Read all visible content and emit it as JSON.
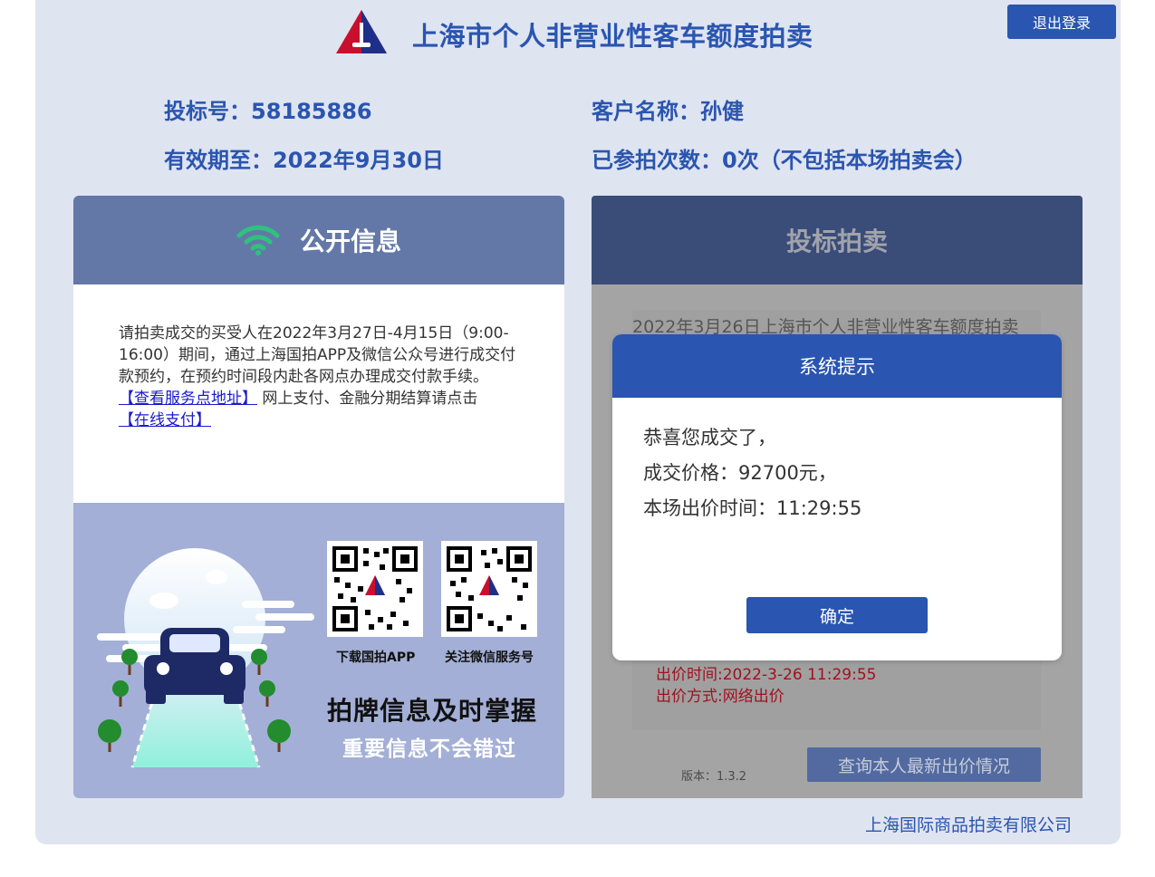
{
  "header": {
    "title": "上海市个人非营业性客车额度拍卖",
    "logout_label": "退出登录"
  },
  "bidder": {
    "bid_no": "投标号：58185886",
    "customer": "客户名称：孙健",
    "valid_until": "有效期至：2022年9月30日",
    "attempts": "已参拍次数：0次（不包括本场拍卖会）"
  },
  "public_info": {
    "title": "公开信息",
    "notice_text": "请拍卖成交的买受人在2022年3月27日-4月15日（9:00-16:00）期间，通过上海国拍APP及微信公众号进行成交付款预约，在预约时间段内赴各网点办理成交付款手续。",
    "service_link": "【查看服务点地址】",
    "pay_text": " 网上支付、金融分期结算请点击",
    "pay_link": "【在线支付】"
  },
  "promo": {
    "qr_app_caption": "下载国拍APP",
    "qr_wechat_caption": "关注微信服务号",
    "slogan_main": "拍牌信息及时掌握",
    "slogan_sub": "重要信息不会错过"
  },
  "bidding": {
    "title": "投标拍卖",
    "auction_name": "2022年3月26日上海市个人非营业性客车额度拍卖",
    "bid_time": "出价时间:2022-3-26 11:29:55",
    "bid_method": "出价方式:网络出价",
    "query_label": "查询本人最新出价情况",
    "version": "版本：1.3.2"
  },
  "footer": {
    "company": "上海国际商品拍卖有限公司"
  },
  "modal": {
    "title": "系统提示",
    "line1": "恭喜您成交了，",
    "line2": "成交价格：92700元，",
    "line3": "本场出价时间：11:29:55",
    "ok_label": "确定"
  },
  "colors": {
    "brand_blue": "#2a55b0",
    "header_bar": "#6478a8",
    "promo_bg": "#a3afd6",
    "alert_red": "#a0111d",
    "wifi_green": "#2ec27e"
  },
  "icons": {
    "logo": "auction-logo-icon",
    "wifi": "wifi-icon",
    "qr": "qr-code-icon"
  }
}
